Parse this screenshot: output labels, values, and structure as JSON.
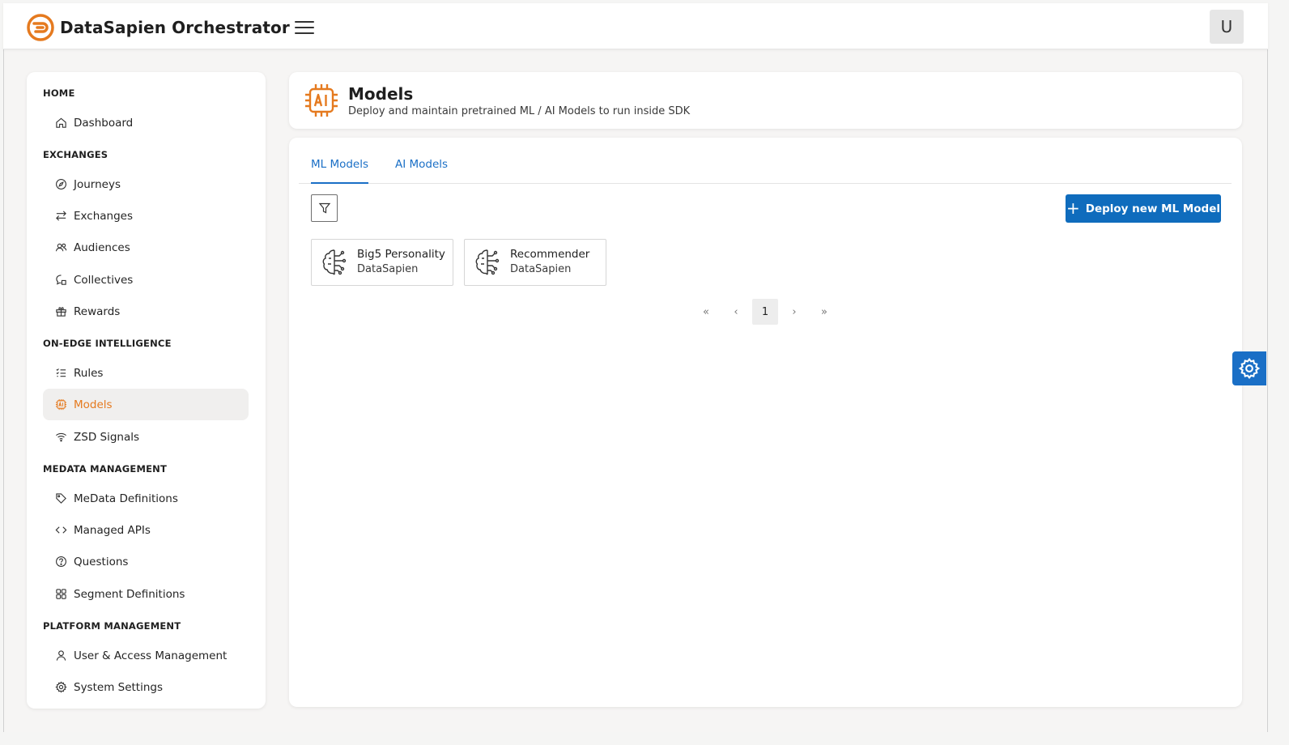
{
  "app": {
    "title": "DataSapien Orchestrator",
    "user_initial": "U"
  },
  "sidebar": {
    "sections": [
      {
        "heading": "HOME",
        "items": [
          {
            "label": "Dashboard",
            "icon": "home-icon"
          }
        ]
      },
      {
        "heading": "EXCHANGES",
        "items": [
          {
            "label": "Journeys",
            "icon": "compass-icon"
          },
          {
            "label": "Exchanges",
            "icon": "arrows-exchange-icon"
          },
          {
            "label": "Audiences",
            "icon": "people-icon"
          },
          {
            "label": "Collectives",
            "icon": "chat-icon"
          },
          {
            "label": "Rewards",
            "icon": "gift-icon"
          }
        ]
      },
      {
        "heading": "ON-EDGE INTELLIGENCE",
        "items": [
          {
            "label": "Rules",
            "icon": "checklist-icon"
          },
          {
            "label": "Models",
            "icon": "ai-chip-icon",
            "active": true
          },
          {
            "label": "ZSD Signals",
            "icon": "wifi-icon"
          }
        ]
      },
      {
        "heading": "MEDATA MANAGEMENT",
        "items": [
          {
            "label": "MeData Definitions",
            "icon": "tag-icon"
          },
          {
            "label": "Managed APIs",
            "icon": "code-icon"
          },
          {
            "label": "Questions",
            "icon": "question-circle-icon"
          },
          {
            "label": "Segment Definitions",
            "icon": "grid-icon"
          }
        ]
      },
      {
        "heading": "PLATFORM MANAGEMENT",
        "items": [
          {
            "label": "User & Access Management",
            "icon": "person-icon"
          },
          {
            "label": "System Settings",
            "icon": "gear-icon"
          }
        ]
      }
    ]
  },
  "header": {
    "title": "Models",
    "subtitle": "Deploy and maintain pretrained ML / AI Models to run inside SDK",
    "icon": "ai-chip-icon"
  },
  "tabs": [
    {
      "label": "ML Models",
      "active": true
    },
    {
      "label": "AI Models",
      "active": false
    }
  ],
  "toolbar": {
    "deploy_label": "Deploy new ML Model",
    "filter_icon": "filter-icon"
  },
  "models": [
    {
      "name": "Big5 Personality",
      "org": "DataSapien",
      "icon": "brain-circuit-icon"
    },
    {
      "name": "Recommender",
      "org": "DataSapien",
      "icon": "brain-circuit-icon"
    }
  ],
  "pagination": {
    "first": "«",
    "prev": "‹",
    "current": "1",
    "next": "›",
    "last": "»"
  },
  "colors": {
    "accent_orange": "#E57A1F",
    "primary_blue": "#0F6CBD",
    "link_blue": "#1A6FC6"
  }
}
